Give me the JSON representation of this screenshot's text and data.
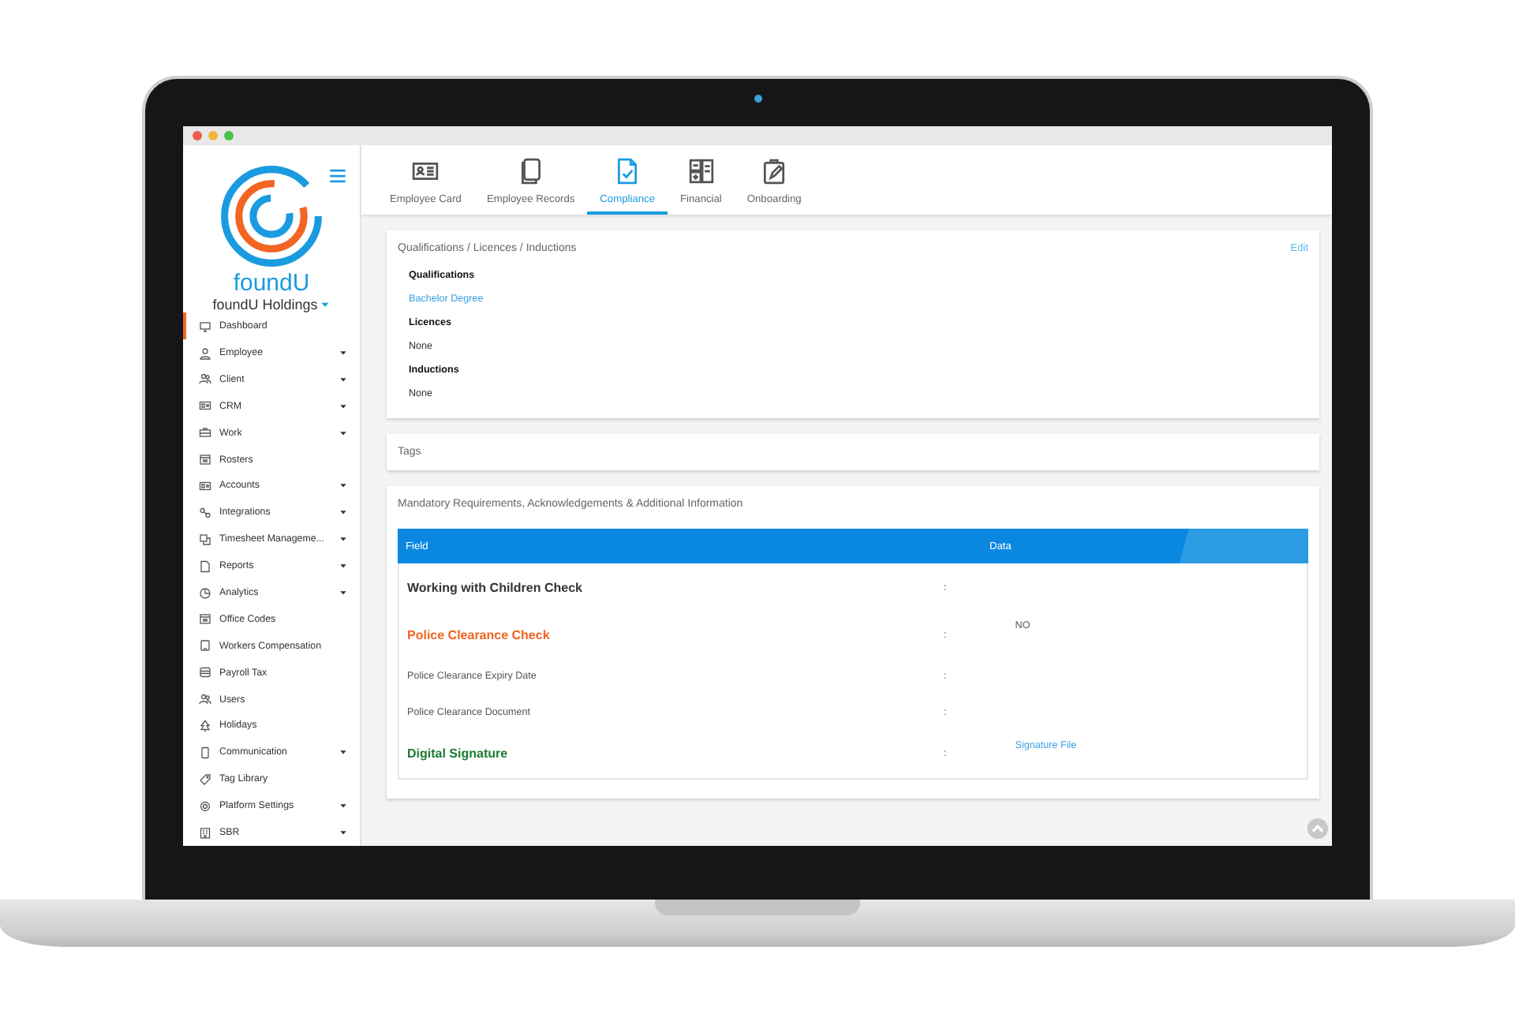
{
  "sidebar": {
    "logo_text": "foundU",
    "company": "foundU Holdings",
    "items": [
      {
        "label": "Dashboard",
        "expandable": false,
        "selected": true
      },
      {
        "label": "Employee",
        "expandable": true,
        "selected": false
      },
      {
        "label": "Client",
        "expandable": true,
        "selected": false
      },
      {
        "label": "CRM",
        "expandable": true,
        "selected": false
      },
      {
        "label": "Work",
        "expandable": true,
        "selected": false
      },
      {
        "label": "Rosters",
        "expandable": false,
        "selected": false
      },
      {
        "label": "Accounts",
        "expandable": true,
        "selected": false
      },
      {
        "label": "Integrations",
        "expandable": true,
        "selected": false
      },
      {
        "label": "Timesheet Manageme...",
        "expandable": true,
        "selected": false
      },
      {
        "label": "Reports",
        "expandable": true,
        "selected": false
      },
      {
        "label": "Analytics",
        "expandable": true,
        "selected": false
      },
      {
        "label": "Office Codes",
        "expandable": false,
        "selected": false
      },
      {
        "label": "Workers Compensation",
        "expandable": false,
        "selected": false
      },
      {
        "label": "Payroll Tax",
        "expandable": false,
        "selected": false
      },
      {
        "label": "Users",
        "expandable": false,
        "selected": false
      },
      {
        "label": "Holidays",
        "expandable": false,
        "selected": false
      },
      {
        "label": "Communication",
        "expandable": true,
        "selected": false
      },
      {
        "label": "Tag Library",
        "expandable": false,
        "selected": false
      },
      {
        "label": "Platform Settings",
        "expandable": true,
        "selected": false
      },
      {
        "label": "SBR",
        "expandable": true,
        "selected": false
      }
    ]
  },
  "tabs": [
    {
      "label": "Employee Card",
      "selected": false
    },
    {
      "label": "Employee Records",
      "selected": false
    },
    {
      "label": "Compliance",
      "selected": true
    },
    {
      "label": "Financial",
      "selected": false
    },
    {
      "label": "Onboarding",
      "selected": false
    }
  ],
  "qualifications_card": {
    "title": "Qualifications / Licences / Inductions",
    "edit": "Edit",
    "sections": [
      {
        "heading": "Qualifications",
        "value": "Bachelor Degree",
        "kind": "link"
      },
      {
        "heading": "Licences",
        "value": "None",
        "kind": "text"
      },
      {
        "heading": "Inductions",
        "value": "None",
        "kind": "text"
      }
    ]
  },
  "tags_card": {
    "title": "Tags"
  },
  "mandatory_card": {
    "title": "Mandatory Requirements, Acknowledgements & Additional Information",
    "table": {
      "columns": [
        "Field",
        "Data"
      ],
      "rows": [
        {
          "field": "Working with Children Check",
          "kind": "heading",
          "color": "#333333",
          "separator": ":"
        },
        {
          "field": "Police Clearance Check",
          "kind": "heading",
          "color": "#f26522",
          "separator": ":",
          "value": {
            "text": "NO",
            "kind": "text"
          }
        },
        {
          "field": "Police Clearance Expiry Date",
          "kind": "detail",
          "separator": ":"
        },
        {
          "field": "Police Clearance Document",
          "kind": "detail",
          "separator": ":"
        },
        {
          "field": "Digital Signature",
          "kind": "heading",
          "color": "#1a7a33",
          "separator": ":",
          "value": {
            "text": "Signature File",
            "kind": "link"
          }
        }
      ]
    }
  }
}
